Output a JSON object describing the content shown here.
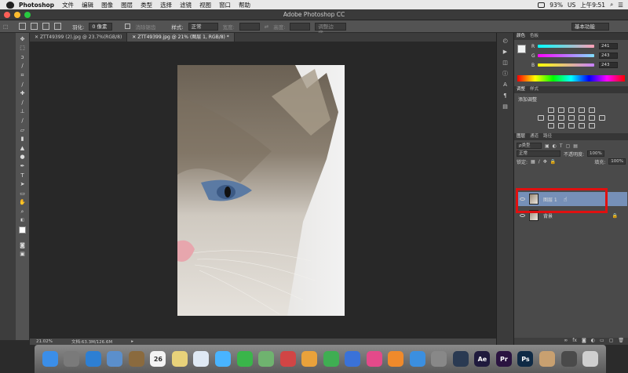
{
  "menubar": {
    "app": "Photoshop",
    "items": [
      "文件",
      "编辑",
      "图像",
      "图层",
      "类型",
      "选择",
      "滤镜",
      "视图",
      "窗口",
      "帮助"
    ],
    "battery": "93%",
    "flag": "US",
    "time": "上午9:51"
  },
  "window": {
    "title": "Adobe Photoshop CC"
  },
  "options": {
    "feather_label": "羽化:",
    "feather_value": "0 像素",
    "antialias_label": "消除锯齿",
    "style_label": "样式:",
    "style_value": "正常",
    "width_label": "宽度:",
    "height_label": "高度:",
    "refine_label": "调整边缘...",
    "workspace": "基本功能"
  },
  "tabs": [
    {
      "label": "ZTT49399 (2).jpg @ 23.7%(RGB/8)"
    },
    {
      "label": "ZTT49399.jpg @ 21% (图层 1, RGB/8) *"
    }
  ],
  "status": {
    "zoom": "21.02%",
    "doc": "文档:63.3M/126.6M"
  },
  "color_panel": {
    "tabs": [
      "颜色",
      "色板"
    ],
    "sliders": [
      {
        "label": "R",
        "value": "241",
        "color": "#ff9fb6"
      },
      {
        "label": "G",
        "value": "243",
        "color": "#7fe0ff"
      },
      {
        "label": "B",
        "value": "243",
        "color": "#c87fff"
      }
    ]
  },
  "adjust_panel": {
    "tabs": [
      "调整",
      "样式"
    ],
    "title": "添加调整"
  },
  "layers_panel": {
    "tabs": [
      "图层",
      "通道",
      "路径"
    ],
    "kind": "ρ类型",
    "blend": "正常",
    "opacity_label": "不透明度:",
    "opacity": "100%",
    "lock_label": "锁定:",
    "fill_label": "填充:",
    "fill": "100%",
    "layers": [
      {
        "name": "图层 1",
        "selected": true
      },
      {
        "name": "背景",
        "selected": false
      }
    ]
  },
  "dock": {
    "items": [
      {
        "name": "finder",
        "color": "#3b8ee8",
        "label": ""
      },
      {
        "name": "launchpad",
        "color": "#7a7a7a",
        "label": ""
      },
      {
        "name": "safari",
        "color": "#2d7fd3",
        "label": ""
      },
      {
        "name": "preview",
        "color": "#5b8fcc",
        "label": ""
      },
      {
        "name": "notes",
        "color": "#8a6a3e",
        "label": ""
      },
      {
        "name": "calendar",
        "color": "#f4f4f4",
        "label": "26"
      },
      {
        "name": "stickies",
        "color": "#e8d27a",
        "label": ""
      },
      {
        "name": "photos",
        "color": "#dfe9f4",
        "label": ""
      },
      {
        "name": "messages",
        "color": "#49b4ff",
        "label": ""
      },
      {
        "name": "facetime",
        "color": "#3ab54a",
        "label": ""
      },
      {
        "name": "maps",
        "color": "#6fb36f",
        "label": ""
      },
      {
        "name": "photo-booth",
        "color": "#d14545",
        "label": ""
      },
      {
        "name": "pages",
        "color": "#e9a23b",
        "label": ""
      },
      {
        "name": "numbers",
        "color": "#3fae52",
        "label": ""
      },
      {
        "name": "keynote",
        "color": "#3a72d8",
        "label": ""
      },
      {
        "name": "itunes",
        "color": "#e34a8a",
        "label": ""
      },
      {
        "name": "ibooks",
        "color": "#f08a2b",
        "label": ""
      },
      {
        "name": "app-store",
        "color": "#3b8fe0",
        "label": ""
      },
      {
        "name": "system-preferences",
        "color": "#888",
        "label": ""
      },
      {
        "name": "quicktime",
        "color": "#2a3a52",
        "label": ""
      },
      {
        "name": "after-effects",
        "color": "#1f1a3d",
        "label": "Ae"
      },
      {
        "name": "premiere",
        "color": "#2a1340",
        "label": "Pr"
      },
      {
        "name": "photoshop",
        "color": "#0f2a45",
        "label": "Ps"
      },
      {
        "name": "user-folder",
        "color": "#c8a070",
        "label": ""
      },
      {
        "name": "downloads",
        "color": "#4a4a4a",
        "label": ""
      },
      {
        "name": "trash",
        "color": "#cfcfcf",
        "label": ""
      }
    ]
  }
}
